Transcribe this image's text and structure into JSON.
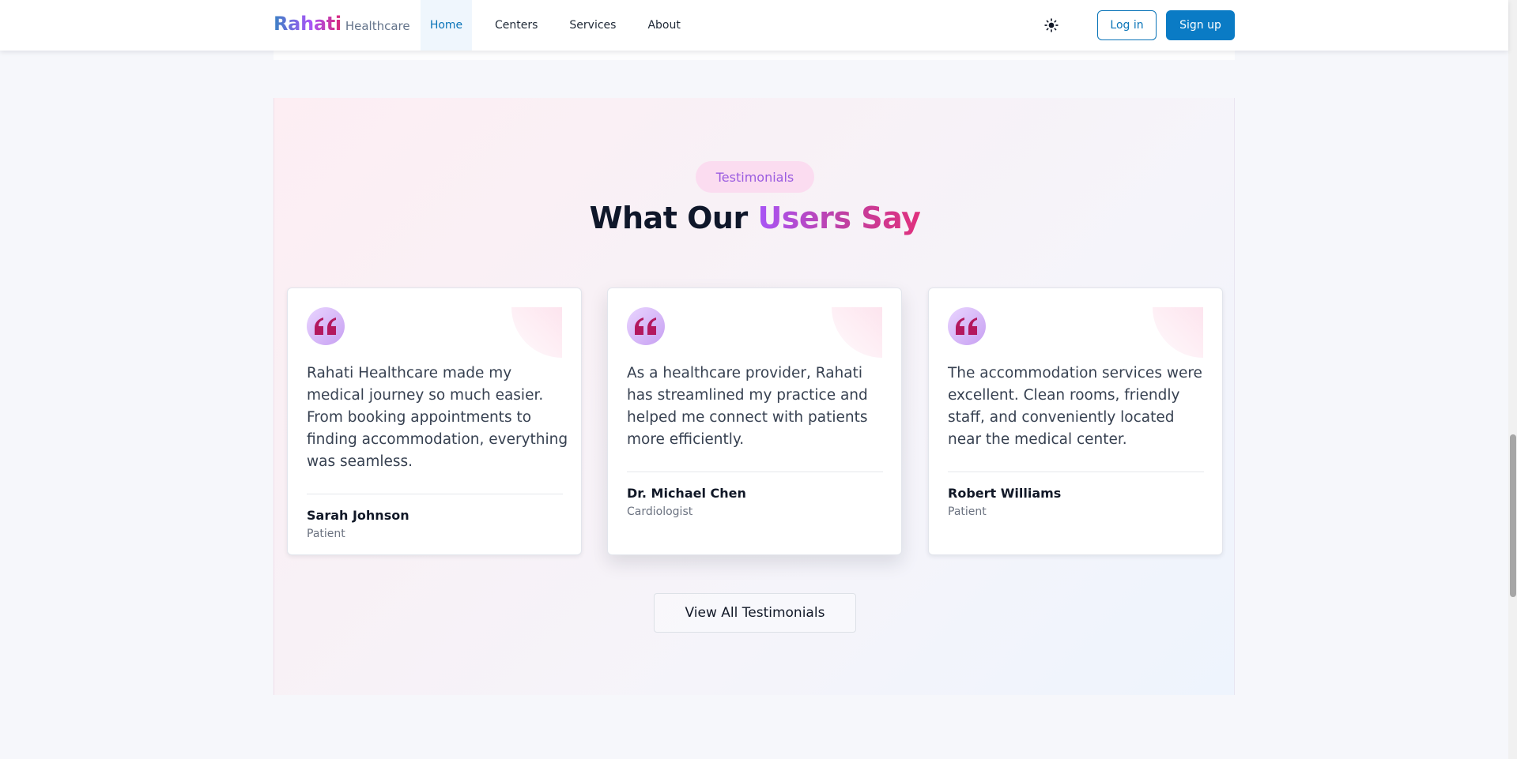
{
  "navbar": {
    "brand": {
      "name": "Rahati",
      "suffix": "Healthcare"
    },
    "links": [
      {
        "label": "Home",
        "active": true
      },
      {
        "label": "Centers",
        "active": false
      },
      {
        "label": "Services",
        "active": false
      },
      {
        "label": "About",
        "active": false
      }
    ],
    "theme_toggle_icon": "sun-icon",
    "login_label": "Log in",
    "signup_label": "Sign up"
  },
  "testimonials": {
    "badge": "Testimonials",
    "title_prefix": "What Our ",
    "title_accent": "Users Say",
    "cards": [
      {
        "quote": "Rahati Healthcare made my medical journey so much easier. From booking appointments to finding accommodation, everything was seamless.",
        "name": "Sarah Johnson",
        "role": "Patient"
      },
      {
        "quote": "As a healthcare provider, Rahati has streamlined my practice and helped me connect with patients more efficiently.",
        "name": "Dr. Michael Chen",
        "role": "Cardiologist"
      },
      {
        "quote": "The accommodation services were excellent. Clean rooms, friendly staff, and conveniently located near the medical center.",
        "name": "Robert Williams",
        "role": "Patient"
      }
    ],
    "view_all_label": "View All Testimonials"
  },
  "colors": {
    "primary": "#0a7bc5",
    "accent_purple": "#a855f7",
    "accent_pink": "#db2777",
    "quote_mark": "#b3185e"
  }
}
